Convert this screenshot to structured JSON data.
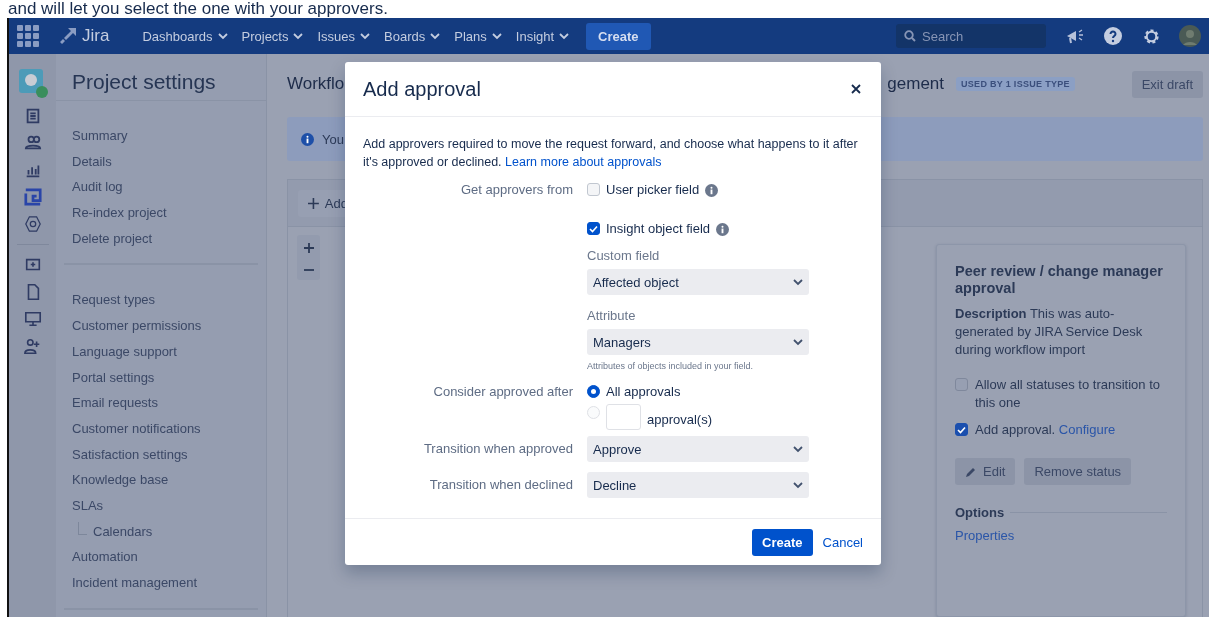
{
  "caption": "and will let you select the one with your approvers.",
  "nav": {
    "product": "Jira",
    "menus": [
      {
        "label": "Dashboards"
      },
      {
        "label": "Projects"
      },
      {
        "label": "Issues"
      },
      {
        "label": "Boards"
      },
      {
        "label": "Plans"
      },
      {
        "label": "Insight"
      }
    ],
    "create": "Create",
    "search": {
      "placeholder": "Search"
    }
  },
  "project_settings": {
    "title": "Project settings",
    "groups": [
      {
        "items": [
          {
            "label": "Summary"
          },
          {
            "label": "Details"
          },
          {
            "label": "Audit log"
          },
          {
            "label": "Re-index project"
          },
          {
            "label": "Delete project"
          }
        ]
      },
      {
        "items": [
          {
            "label": "Request types"
          },
          {
            "label": "Customer permissions"
          },
          {
            "label": "Language support"
          },
          {
            "label": "Portal settings"
          },
          {
            "label": "Email requests"
          },
          {
            "label": "Customer notifications"
          },
          {
            "label": "Satisfaction settings"
          },
          {
            "label": "Knowledge base"
          },
          {
            "label": "SLAs",
            "children": [
              {
                "label": "Calendars"
              }
            ]
          },
          {
            "label": "Automation"
          },
          {
            "label": "Incident management"
          }
        ]
      }
    ]
  },
  "workflow": {
    "title_start": "Workflo",
    "title_end": "gement",
    "badge": "USED BY 1 ISSUE TYPE",
    "exit_button": "Exit draft",
    "info_text": "You",
    "add_button": "Add"
  },
  "status_card": {
    "title": "Peer review / change manager approval",
    "description": "**Description** This was auto-generated by JIRA Service Desk during workflow import",
    "options": [
      {
        "label": "Allow all statuses to transition to this one",
        "checked": false
      },
      {
        "label": "Add approval.",
        "checked": true,
        "link": "Configure"
      }
    ],
    "buttons": [
      {
        "label": "Edit",
        "kind": "edit"
      },
      {
        "label": "Remove status",
        "kind": "plain"
      }
    ],
    "options_heading": "Options",
    "properties_link": "Properties"
  },
  "dialog": {
    "title": "Add approval",
    "intro": "Add approvers required to move the request forward, and choose what happens to it after it's approved or declined.",
    "intro_link": "Learn more about approvals",
    "approvers_label": "Get approvers from",
    "sources": [
      {
        "label": "User picker field",
        "checked": false
      },
      {
        "label": "Insight object field",
        "checked": true
      }
    ],
    "custom_field": {
      "label": "Custom field",
      "value": "Affected object"
    },
    "attribute": {
      "label": "Attribute",
      "value": "Managers",
      "help": "Attributes of objects included in your field."
    },
    "approved_after_label": "Consider approved after",
    "approved_after_options": [
      {
        "kind": "all",
        "label": "All approvals",
        "selected": true
      },
      {
        "kind": "count",
        "label": "approval(s)",
        "selected": false
      }
    ],
    "approved_transition": {
      "label": "Transition when approved",
      "value": "Approve"
    },
    "declined_transition": {
      "label": "Transition when declined",
      "value": "Decline"
    },
    "create_button": "Create",
    "cancel_link": "Cancel"
  }
}
